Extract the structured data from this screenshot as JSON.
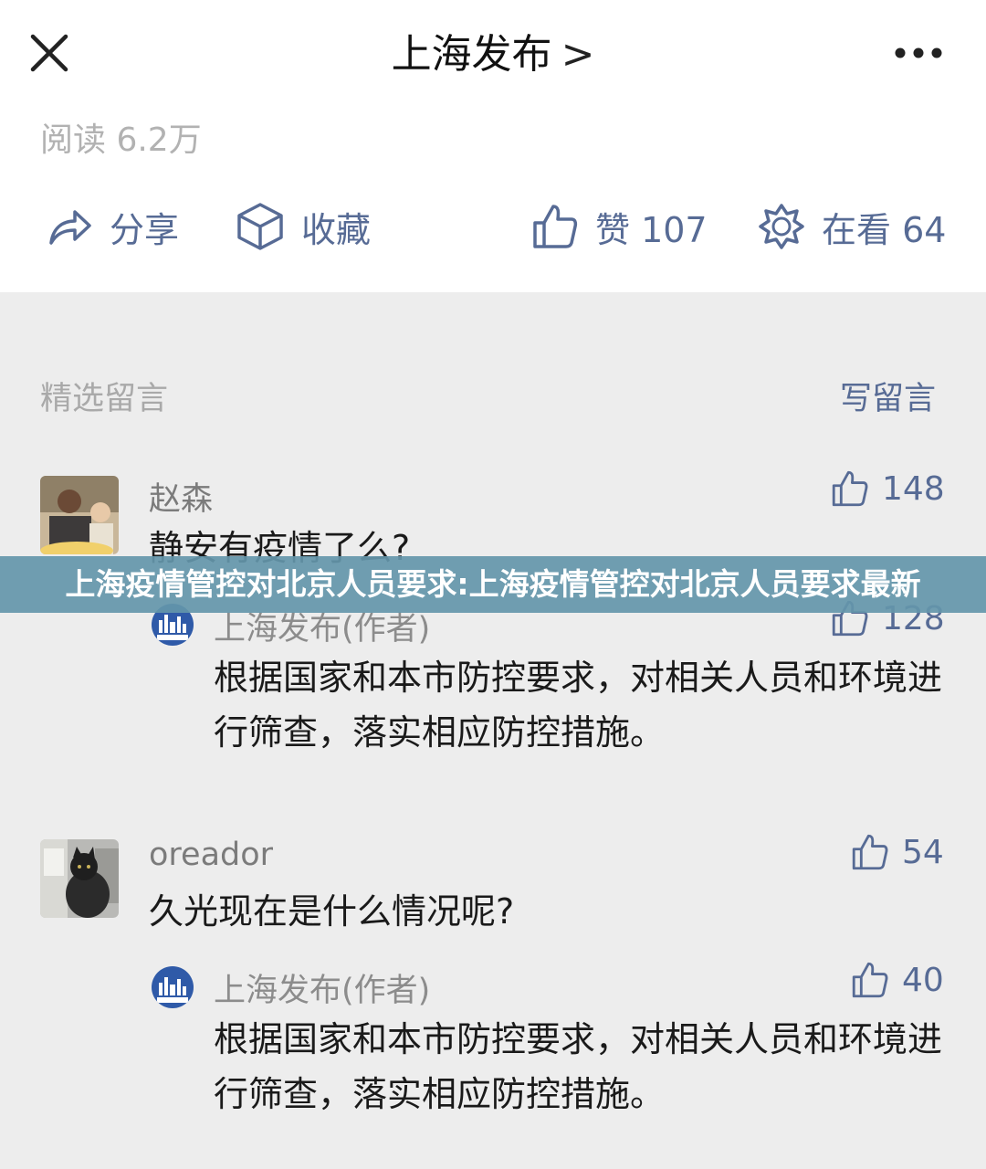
{
  "header": {
    "title": "上海发布",
    "chevron": ">"
  },
  "article": {
    "reads": "阅读 6.2万"
  },
  "actions": {
    "share": "分享",
    "favorite": "收藏",
    "like": "赞 107",
    "watching": "在看 64"
  },
  "comments_section": {
    "title": "精选留言",
    "write": "写留言"
  },
  "comments": [
    {
      "nickname": "赵森",
      "content": "静安有疫情了么?",
      "likes": "148",
      "reply": {
        "author": "上海发布(作者)",
        "likes": "128",
        "content": "根据国家和本市防控要求，对相关人员和环境进行筛查，落实相应防控措施。"
      }
    },
    {
      "nickname": "oreador",
      "content": "久光现在是什么情况呢?",
      "likes": "54",
      "reply": {
        "author": "上海发布(作者)",
        "likes": "40",
        "content": "根据国家和本市防控要求，对相关人员和环境进行筛查，落实相应防控措施。"
      }
    }
  ],
  "banner": {
    "text": "上海疫情管控对北京人员要求:上海疫情管控对北京人员要求最新"
  },
  "colors": {
    "link": "#576b95",
    "background": "#ededed",
    "banner": "#6496aa"
  },
  "icons": [
    "close-icon",
    "more-icon",
    "share-icon",
    "favorite-icon",
    "thumbs-up-icon",
    "watching-icon"
  ]
}
